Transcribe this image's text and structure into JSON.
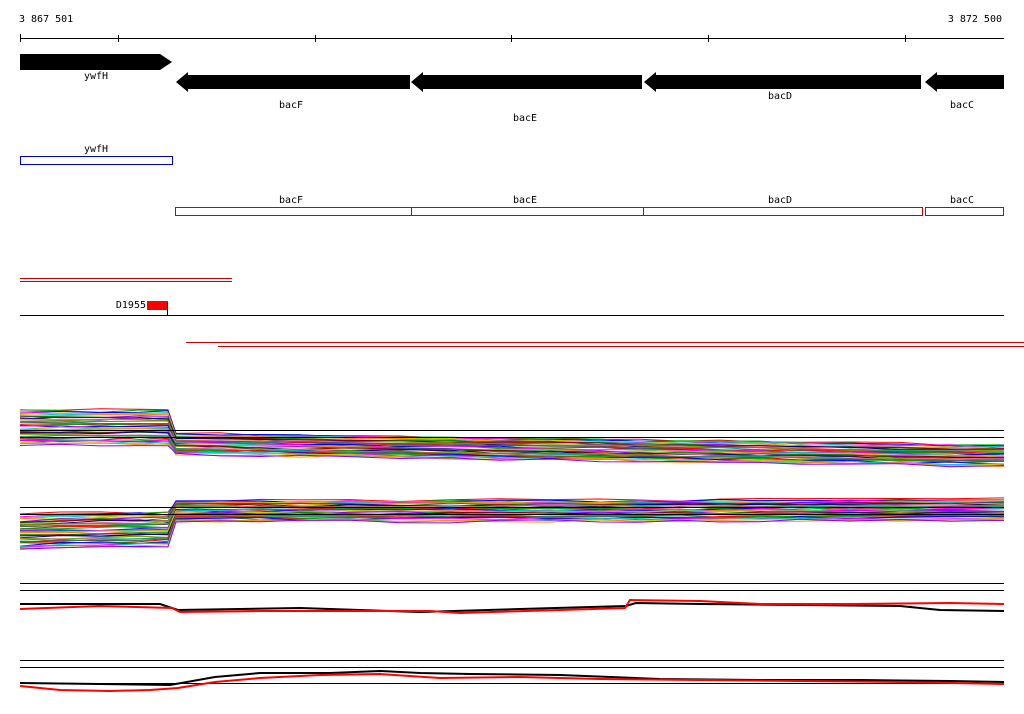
{
  "ruler": {
    "start_label": "3 867 501",
    "end_label": "3 872 500"
  },
  "genes": [
    {
      "name": "ywfH",
      "strand": "+"
    },
    {
      "name": "bacF",
      "strand": "-"
    },
    {
      "name": "bacE",
      "strand": "-"
    },
    {
      "name": "bacD",
      "strand": "-"
    },
    {
      "name": "bacC",
      "strand": "-"
    }
  ],
  "annotations": {
    "ywfH": "ywfH",
    "bacF": "bacF",
    "bacE": "bacE",
    "bacD": "bacD",
    "bacC": "bacC"
  },
  "probe": {
    "label": "D1955"
  },
  "colors": {
    "gene_arrow": "#000000",
    "forward_feature": "#0000cc",
    "reverse_feature": "#cc0000",
    "probe": "#ff0000",
    "signal_red": "#ff0000",
    "signal_black": "#000000"
  }
}
